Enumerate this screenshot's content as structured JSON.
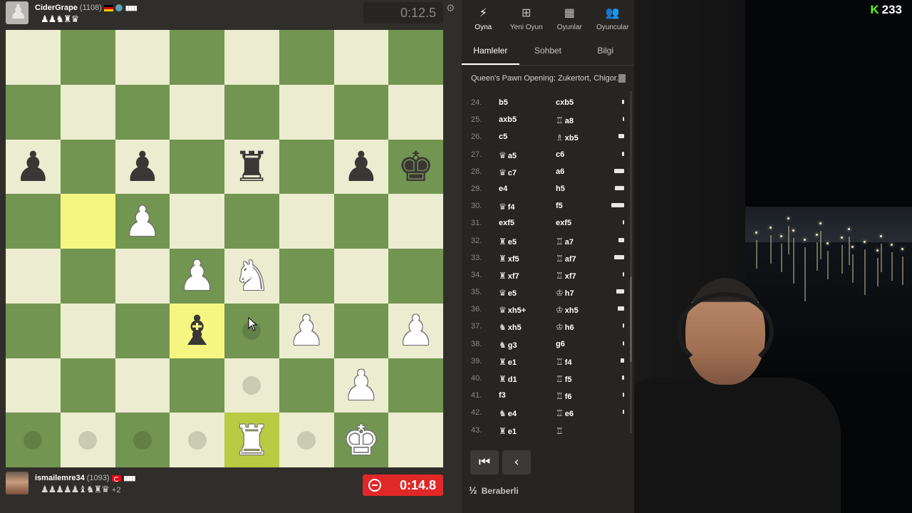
{
  "top_player": {
    "name": "CiderGrape",
    "rating": "(1108)",
    "captured": "♟♟♞♜♛",
    "clock": "0:12.5"
  },
  "bottom_player": {
    "name": "ismailemre34",
    "rating": "(1093)",
    "captured": "♟♟♟♟♟♝♞♜♛",
    "captured_extra": "+2",
    "clock": "0:14.8"
  },
  "nav": [
    {
      "label": "Oyna",
      "icon": "⚡"
    },
    {
      "label": "Yeni Oyun",
      "icon": "⊞"
    },
    {
      "label": "Oyunlar",
      "icon": "▦"
    },
    {
      "label": "Oyuncular",
      "icon": "👥"
    }
  ],
  "tabs": [
    "Hamleler",
    "Sohbet",
    "Bilgi"
  ],
  "opening": "Queen's Pawn Opening: Zukertort, Chigor...",
  "board": [
    [
      "",
      "",
      "",
      "",
      "",
      "",
      "",
      ""
    ],
    [
      "",
      "",
      "",
      "",
      "",
      "",
      "",
      ""
    ],
    [
      "bp",
      "",
      "bp",
      "",
      "br",
      "",
      "bp",
      "bk"
    ],
    [
      "",
      "",
      "wp",
      "",
      "",
      "",
      "",
      ""
    ],
    [
      "",
      "",
      "",
      "wp",
      "wn",
      "",
      "",
      ""
    ],
    [
      "",
      "",
      "",
      "bb",
      "",
      "wp",
      "",
      "wp"
    ],
    [
      "",
      "",
      "",
      "",
      "",
      "",
      "wp",
      ""
    ],
    [
      "",
      "",
      "",
      "",
      "wr",
      "",
      "wk",
      ""
    ]
  ],
  "highlights": [
    [
      3,
      1
    ],
    [
      5,
      3
    ],
    [
      7,
      4
    ]
  ],
  "hints": [
    [
      5,
      4
    ],
    [
      6,
      4
    ],
    [
      7,
      0
    ],
    [
      7,
      1
    ],
    [
      7,
      2
    ],
    [
      7,
      3
    ],
    [
      7,
      5
    ]
  ],
  "moves": [
    {
      "n": "24.",
      "w": "b5",
      "wf": "",
      "b": "cxb5",
      "bf": "",
      "ev": 3
    },
    {
      "n": "25.",
      "w": "axb5",
      "wf": "",
      "b": "a8",
      "bf": "♖",
      "ev": 2
    },
    {
      "n": "26.",
      "w": "c5",
      "wf": "",
      "b": "xb5",
      "bf": "♗",
      "ev": 8
    },
    {
      "n": "27.",
      "w": "a5",
      "wf": "♛",
      "b": "c6",
      "bf": "",
      "ev": 3
    },
    {
      "n": "28.",
      "w": "c7",
      "wf": "♛",
      "b": "a6",
      "bf": "",
      "ev": 14
    },
    {
      "n": "29.",
      "w": "e4",
      "wf": "",
      "b": "h5",
      "bf": "",
      "ev": 13
    },
    {
      "n": "30.",
      "w": "f4",
      "wf": "♛",
      "b": "f5",
      "bf": "",
      "ev": 18
    },
    {
      "n": "31.",
      "w": "exf5",
      "wf": "",
      "b": "exf5",
      "bf": "",
      "ev": 2
    },
    {
      "n": "32.",
      "w": "e5",
      "wf": "♜",
      "b": "a7",
      "bf": "♖",
      "ev": 8
    },
    {
      "n": "33.",
      "w": "xf5",
      "wf": "♜",
      "b": "af7",
      "bf": "♖",
      "ev": 14
    },
    {
      "n": "34.",
      "w": "xf7",
      "wf": "♜",
      "b": "xf7",
      "bf": "♖",
      "ev": 2
    },
    {
      "n": "35.",
      "w": "e5",
      "wf": "♛",
      "b": "h7",
      "bf": "♔",
      "ev": 11
    },
    {
      "n": "36.",
      "w": "xh5+",
      "wf": "♛",
      "b": "xh5",
      "bf": "♔",
      "ev": 9
    },
    {
      "n": "37.",
      "w": "xh5",
      "wf": "♞",
      "b": "h6",
      "bf": "♔",
      "ev": 2
    },
    {
      "n": "38.",
      "w": "g3",
      "wf": "♞",
      "b": "g6",
      "bf": "",
      "ev": 2
    },
    {
      "n": "39.",
      "w": "e1",
      "wf": "♜",
      "b": "f4",
      "bf": "♖",
      "ev": 5
    },
    {
      "n": "40.",
      "w": "d1",
      "wf": "♜",
      "b": "f5",
      "bf": "♖",
      "ev": 3
    },
    {
      "n": "41.",
      "w": "f3",
      "wf": "",
      "b": "f6",
      "bf": "♖",
      "ev": 2
    },
    {
      "n": "42.",
      "w": "e4",
      "wf": "♞",
      "b": "e6",
      "bf": "♖",
      "ev": 2
    },
    {
      "n": "43.",
      "w": "e1",
      "wf": "♜",
      "b": "",
      "bf": "♖",
      "ev": 0
    }
  ],
  "controls": [
    "⏮",
    "‹"
  ],
  "draw": {
    "half": "½",
    "label": "Beraberli"
  },
  "stream_badge": {
    "k": "K",
    "count": "233"
  },
  "colors": {
    "light_square": "#ebecd0",
    "dark_square": "#739552",
    "clock_active": "#e02828"
  }
}
